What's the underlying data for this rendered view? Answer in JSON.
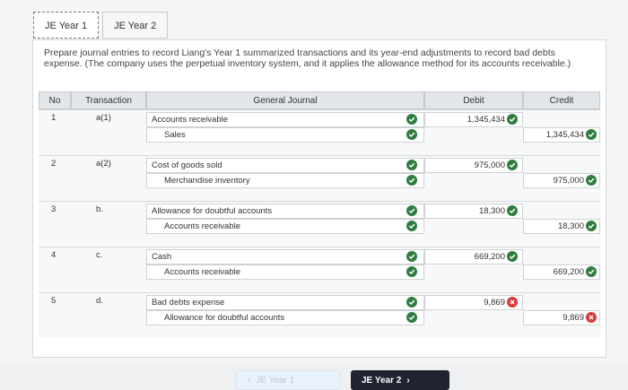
{
  "tabs": [
    {
      "label": "JE Year 1",
      "active": true
    },
    {
      "label": "JE Year 2",
      "active": false
    }
  ],
  "instructions": "Prepare journal entries to record Liang's Year 1 summarized transactions and its year-end adjustments to record bad debts expense. (The company uses the perpetual inventory system, and it applies the allowance method for its accounts receivable.)",
  "table": {
    "headers": {
      "no": "No",
      "transaction": "Transaction",
      "general_journal": "General Journal",
      "debit": "Debit",
      "credit": "Credit"
    },
    "entries": [
      {
        "no": "1",
        "transaction": "a(1)",
        "debit_account": "Accounts receivable",
        "credit_account": "Sales",
        "debit": "1,345,434",
        "credit": "1,345,434",
        "debit_status": "correct",
        "credit_status": "correct"
      },
      {
        "no": "2",
        "transaction": "a(2)",
        "debit_account": "Cost of goods sold",
        "credit_account": "Merchandise inventory",
        "debit": "975,000",
        "credit": "975,000",
        "debit_status": "correct",
        "credit_status": "correct"
      },
      {
        "no": "3",
        "transaction": "b.",
        "debit_account": "Allowance for doubtful accounts",
        "credit_account": "Accounts receivable",
        "debit": "18,300",
        "credit": "18,300",
        "debit_status": "correct",
        "credit_status": "correct"
      },
      {
        "no": "4",
        "transaction": "c.",
        "debit_account": "Cash",
        "credit_account": "Accounts receivable",
        "debit": "669,200",
        "credit": "669,200",
        "debit_status": "correct",
        "credit_status": "correct"
      },
      {
        "no": "5",
        "transaction": "d.",
        "debit_account": "Bad debts expense",
        "credit_account": "Allowance for doubtful accounts",
        "debit": "9,869",
        "credit": "9,869",
        "debit_status": "incorrect",
        "credit_status": "incorrect"
      }
    ]
  },
  "nav": {
    "prev_label": "JE Year 1",
    "next_label": "JE Year 2"
  },
  "colors": {
    "correct": "#2e7d3f",
    "incorrect": "#d93a3a",
    "next_button": "#1f2430"
  }
}
